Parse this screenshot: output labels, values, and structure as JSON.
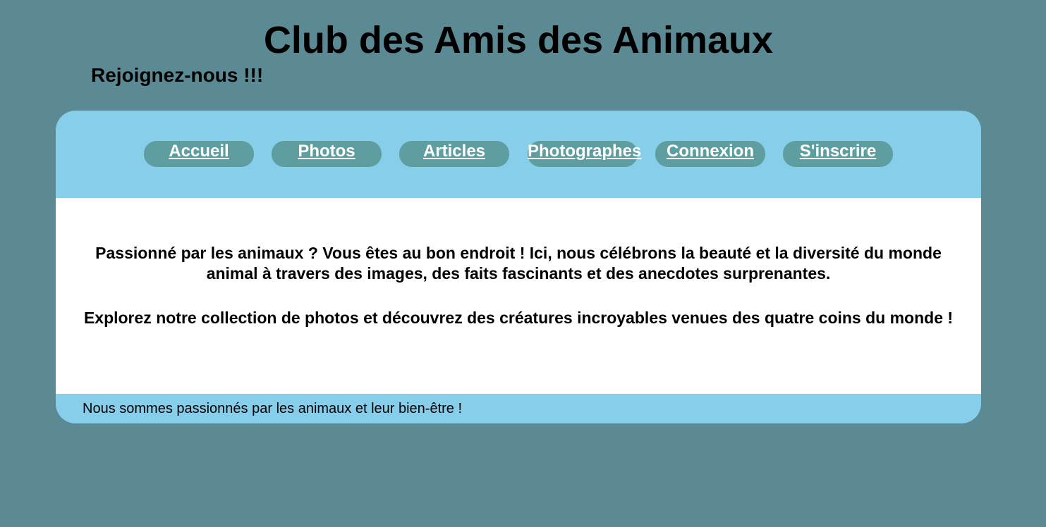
{
  "header": {
    "title": "Club des Amis des Animaux",
    "subtitle": "Rejoignez-nous !!!"
  },
  "nav": {
    "items": [
      {
        "label": "Accueil"
      },
      {
        "label": "Photos"
      },
      {
        "label": "Articles"
      },
      {
        "label": "Photographes"
      },
      {
        "label": "Connexion"
      },
      {
        "label": "S'inscrire"
      }
    ]
  },
  "main": {
    "paragraph_1": "Passionné par les animaux ? Vous êtes au bon endroit ! Ici, nous célébrons la beauté et la diversité du monde animal à travers des images, des faits fascinants et des anecdotes surprenantes.",
    "paragraph_2": "Explorez notre collection de photos et découvrez des créatures incroyables venues des quatre coins du monde !"
  },
  "footer": {
    "text": "Nous sommes passionnés par les animaux et leur bien-être !"
  },
  "colors": {
    "page_background": "#5b8a95",
    "panel_background": "#87ceeb",
    "nav_pill": "#5f9ea0",
    "nav_text": "#ffffff",
    "content_background": "#ffffff"
  }
}
